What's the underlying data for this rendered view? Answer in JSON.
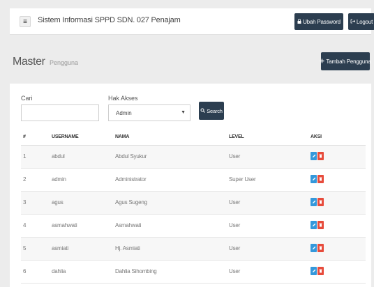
{
  "navbar": {
    "menu_icon": "hamburger-icon",
    "app_title": "Sistem Informasi SPPD SDN. 027 Penajam",
    "change_password_label": "Ubah Password",
    "logout_label": "Logout"
  },
  "page": {
    "title": "Master",
    "subtitle": "Pengguna",
    "add_button_label": "Tambah Pengguna"
  },
  "filters": {
    "cari_label": "Cari",
    "cari_value": "",
    "hak_akses_label": "Hak Akses",
    "hak_akses_selected": "Admin",
    "search_button_label": "Search"
  },
  "table": {
    "columns": [
      "#",
      "USERNAME",
      "NAMA",
      "LEVEL",
      "AKSI"
    ],
    "rows": [
      {
        "no": "1",
        "username": "abdul",
        "nama": "Abdul Syukur",
        "level": "User"
      },
      {
        "no": "2",
        "username": "admin",
        "nama": "Administrator",
        "level": "Super User"
      },
      {
        "no": "3",
        "username": "agus",
        "nama": "Agus Sugeng",
        "level": "User"
      },
      {
        "no": "4",
        "username": "asmahwati",
        "nama": "Asmahwati",
        "level": "User"
      },
      {
        "no": "5",
        "username": "asmiati",
        "nama": "Hj. Asmiati",
        "level": "User"
      },
      {
        "no": "6",
        "username": "dahlia",
        "nama": "Dahlia Sihombing",
        "level": "User"
      }
    ]
  },
  "colors": {
    "dark_button": "#2c3e50",
    "edit_button": "#3498db",
    "delete_button": "#e74c3c"
  }
}
